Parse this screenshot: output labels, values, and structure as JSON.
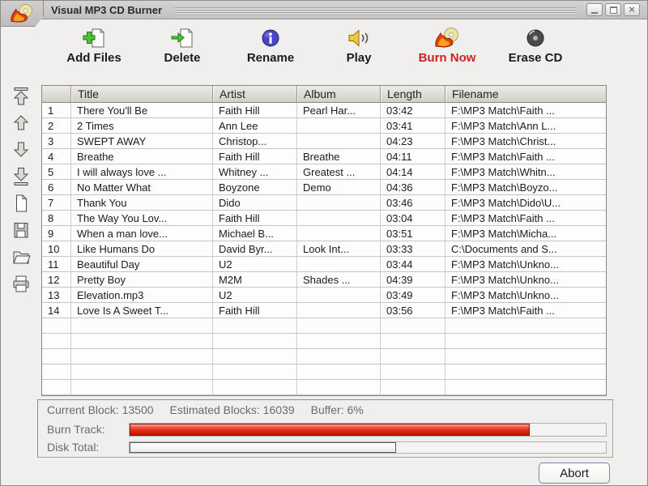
{
  "window": {
    "title": "Visual MP3 CD Burner",
    "controls": [
      "minimize",
      "maximize",
      "close"
    ]
  },
  "toolbar": {
    "buttons": [
      {
        "label": "Add Files",
        "icon": "add-files-icon"
      },
      {
        "label": "Delete",
        "icon": "delete-icon"
      },
      {
        "label": "Rename",
        "icon": "rename-icon"
      },
      {
        "label": "Play",
        "icon": "play-icon"
      },
      {
        "label": "Burn Now",
        "icon": "burn-now-icon",
        "text_color": "#cc2222"
      },
      {
        "label": "Erase CD",
        "icon": "erase-cd-icon"
      }
    ]
  },
  "sidebar": {
    "icons": [
      "move-to-top-icon",
      "move-up-icon",
      "move-down-icon",
      "move-to-bottom-icon",
      "new-file-icon",
      "save-icon",
      "open-folder-icon",
      "print-icon"
    ]
  },
  "table": {
    "columns": [
      {
        "key": "num",
        "label": ""
      },
      {
        "key": "title",
        "label": "Title"
      },
      {
        "key": "artist",
        "label": "Artist"
      },
      {
        "key": "album",
        "label": "Album"
      },
      {
        "key": "length",
        "label": "Length"
      },
      {
        "key": "filename",
        "label": "Filename"
      }
    ],
    "rows": [
      {
        "num": "1",
        "title": "There You'll Be",
        "artist": "Faith Hill",
        "album": "Pearl Har...",
        "length": "03:42",
        "filename": "F:\\MP3 Match\\Faith ..."
      },
      {
        "num": "2",
        "title": "2 Times",
        "artist": "Ann Lee",
        "album": "",
        "length": "03:41",
        "filename": "F:\\MP3 Match\\Ann L..."
      },
      {
        "num": "3",
        "title": "SWEPT AWAY",
        "artist": "Christop...",
        "album": "",
        "length": "04:23",
        "filename": "F:\\MP3 Match\\Christ..."
      },
      {
        "num": "4",
        "title": "Breathe",
        "artist": "Faith Hill",
        "album": "Breathe",
        "length": "04:11",
        "filename": "F:\\MP3 Match\\Faith ..."
      },
      {
        "num": "5",
        "title": "I will always love ...",
        "artist": "Whitney ...",
        "album": "Greatest ...",
        "length": "04:14",
        "filename": "F:\\MP3 Match\\Whitn..."
      },
      {
        "num": "6",
        "title": "No Matter What",
        "artist": "Boyzone",
        "album": "Demo",
        "length": "04:36",
        "filename": "F:\\MP3 Match\\Boyzo..."
      },
      {
        "num": "7",
        "title": "Thank You",
        "artist": "Dido",
        "album": "",
        "length": "03:46",
        "filename": "F:\\MP3 Match\\Dido\\U..."
      },
      {
        "num": "8",
        "title": "The Way You Lov...",
        "artist": "Faith Hill",
        "album": "",
        "length": "03:04",
        "filename": "F:\\MP3 Match\\Faith ..."
      },
      {
        "num": "9",
        "title": "When a man love...",
        "artist": "Michael B...",
        "album": "",
        "length": "03:51",
        "filename": "F:\\MP3 Match\\Micha..."
      },
      {
        "num": "10",
        "title": "Like Humans Do",
        "artist": "David Byr...",
        "album": "Look Int...",
        "length": "03:33",
        "filename": "C:\\Documents and S..."
      },
      {
        "num": "11",
        "title": "Beautiful Day",
        "artist": "U2",
        "album": "",
        "length": "03:44",
        "filename": "F:\\MP3 Match\\Unkno..."
      },
      {
        "num": "12",
        "title": "Pretty Boy",
        "artist": "M2M",
        "album": "Shades ...",
        "length": "04:39",
        "filename": "F:\\MP3 Match\\Unkno..."
      },
      {
        "num": "13",
        "title": "Elevation.mp3",
        "artist": "U2",
        "album": "",
        "length": "03:49",
        "filename": "F:\\MP3 Match\\Unkno..."
      },
      {
        "num": "14",
        "title": "Love Is A Sweet T...",
        "artist": "Faith Hill",
        "album": "",
        "length": "03:56",
        "filename": "F:\\MP3 Match\\Faith ..."
      }
    ],
    "empty_row_count": 5
  },
  "status": {
    "items": [
      "Current Block: 13500",
      "Estimated Blocks: 16039",
      "Buffer: 6%"
    ]
  },
  "progress": {
    "burn_track_label": "Burn Track:",
    "burn_track_percent": 84,
    "disk_total_label": "Disk Total:",
    "disk_total_percent": 56,
    "burn_fill_color": "#d92c12"
  },
  "abort": {
    "label": "Abort"
  }
}
